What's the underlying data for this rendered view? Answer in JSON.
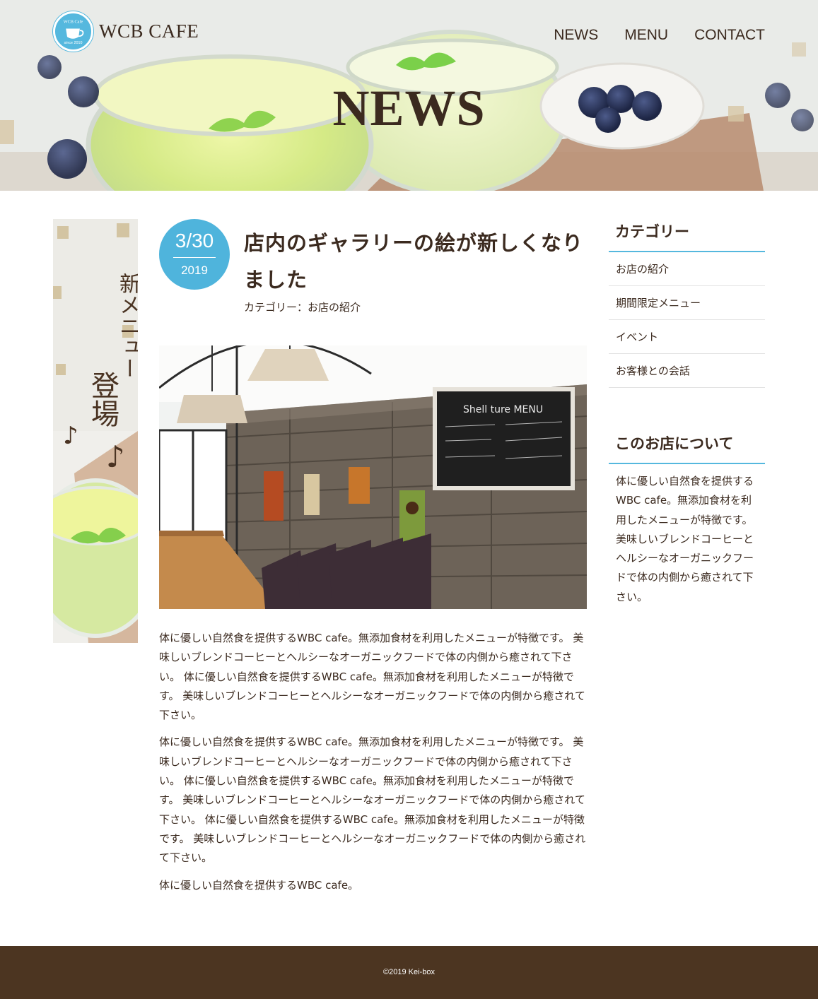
{
  "header": {
    "logo_text": "WCB CAFE",
    "logo_badge_top": "WCB Cafe",
    "logo_badge_bottom": "since 2010",
    "nav": [
      "NEWS",
      "MENU",
      "CONTACT"
    ],
    "hero_title": "NEWS"
  },
  "banner": {
    "line1": "新メニュー",
    "line2": "登場",
    "notes": "♪"
  },
  "article": {
    "date_md": "3/30",
    "date_year": "2019",
    "title": "店内のギャラリーの絵が新しくなりました",
    "category": "カテゴリー：お店の紹介",
    "photo_menu_title": "Shell ture MENU",
    "paragraphs": [
      "体に優しい自然食を提供するWBC cafe。無添加食材を利用したメニューが特徴です。 美味しいブレンドコーヒーとヘルシーなオーガニックフードで体の内側から癒されて下さい。 体に優しい自然食を提供するWBC cafe。無添加食材を利用したメニューが特徴です。 美味しいブレンドコーヒーとヘルシーなオーガニックフードで体の内側から癒されて下さい。",
      "体に優しい自然食を提供するWBC cafe。無添加食材を利用したメニューが特徴です。 美味しいブレンドコーヒーとヘルシーなオーガニックフードで体の内側から癒されて下さい。 体に優しい自然食を提供するWBC cafe。無添加食材を利用したメニューが特徴です。 美味しいブレンドコーヒーとヘルシーなオーガニックフードで体の内側から癒されて下さい。 体に優しい自然食を提供するWBC cafe。無添加食材を利用したメニューが特徴です。 美味しいブレンドコーヒーとヘルシーなオーガニックフードで体の内側から癒されて下さい。",
      "体に優しい自然食を提供するWBC cafe。"
    ]
  },
  "sidebar": {
    "category_heading": "カテゴリー",
    "categories": [
      "お店の紹介",
      "期間限定メニュー",
      "イベント",
      "お客様との会話"
    ],
    "about_heading": "このお店について",
    "about_text": "体に優しい自然食を提供するWBC cafe。無添加食材を利用したメニューが特徴です。 美味しいブレンドコーヒーとヘルシーなオーガニックフードで体の内側から癒されて下さい。"
  },
  "footer": {
    "copyright": "©2019 Kei-box"
  },
  "colors": {
    "accent_blue": "#55b8de",
    "brown_text": "#3b2a1f",
    "footer_bg": "#4c3521"
  }
}
